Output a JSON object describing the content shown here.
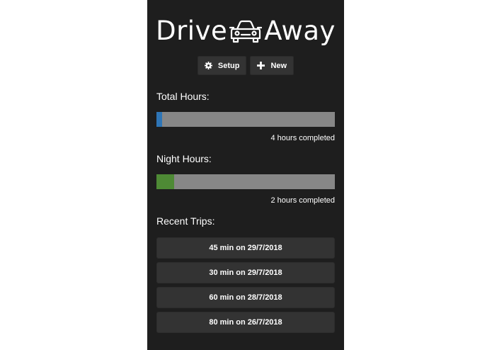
{
  "brand": {
    "word1": "Drive",
    "word2": "Away",
    "icon": "car-icon"
  },
  "toolbar": {
    "setup_label": "Setup",
    "setup_icon": "gear-icon",
    "new_label": "New",
    "new_icon": "plus-icon"
  },
  "total": {
    "title": "Total Hours:",
    "caption": "4 hours completed",
    "progress_fraction": 0.03,
    "color": "#2e75b6"
  },
  "night": {
    "title": "Night Hours:",
    "caption": "2 hours completed",
    "progress_fraction": 0.1,
    "color": "#4e8a35"
  },
  "recent": {
    "title": "Recent Trips:",
    "trips": [
      {
        "label": "45 min on 29/7/2018"
      },
      {
        "label": "30 min on 29/7/2018"
      },
      {
        "label": "60 min on 28/7/2018"
      },
      {
        "label": "80 min on 26/7/2018"
      }
    ]
  },
  "colors": {
    "panel": "#1e1e1e",
    "button": "#333333",
    "track": "#878787"
  }
}
